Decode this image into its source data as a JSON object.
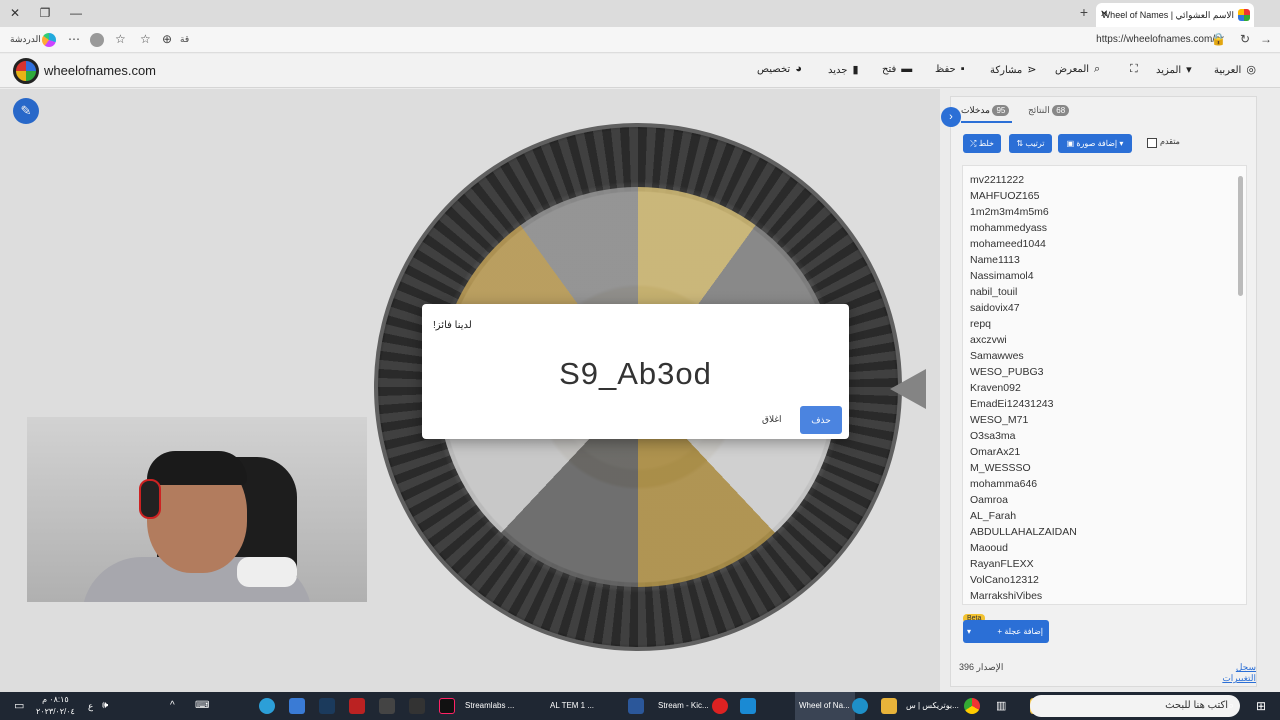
{
  "browser": {
    "tab_title": "الاسم العشوائي | Wheel of Names",
    "tab_close": "✕",
    "new_tab": "+",
    "url": "https://wheelofnames.com/ar",
    "profile_label": "الدردشة",
    "win_close": "✕",
    "win_restore": "❐",
    "win_min": "—",
    "reader_icon": "قة"
  },
  "site": {
    "title": "wheelofnames.com",
    "nav": {
      "language": "العربية",
      "more": "المزيد",
      "gallery": "المعرض",
      "share": "مشاركة",
      "save": "حفظ",
      "open": "فتح",
      "new": "جديد",
      "customize": "تخصيص"
    }
  },
  "panel": {
    "tab_entries": "مدخلات",
    "entries_count": "95",
    "tab_results": "النتائج",
    "results_count": "68",
    "shuffle": "خلط",
    "sort": "ترتيب",
    "add_image": "إضافة صورة",
    "advanced": "متقدم",
    "entries": [
      "mv2211222",
      "MAHFUOZ165",
      "1m2m3m4m5m6",
      "mohammedyass",
      "mohameed1044",
      "Name1113",
      "Nassimamol4",
      "nabil_touil",
      "saidovix47",
      "repq",
      "axczvwi",
      "Samawwes",
      "WESO_PUBG3",
      "Kraven092",
      "EmadEi12431243",
      "WESO_M71",
      "O3sa3ma",
      "OmarAx21",
      "M_WESSSO",
      "mohamma646",
      "Oamroa",
      "AL_Farah",
      "ABDULLAHALZAIDAN",
      "Maooud",
      "RayanFLEXX",
      "VolCano12312",
      "MarrakshiVibes"
    ],
    "beta": "Beta",
    "add_wheel": "إضافة عجلة",
    "version_label": "الإصدار",
    "version": "396",
    "changelog": "سجل التغييرات"
  },
  "dialog": {
    "title": "لدينا فائز!",
    "winner": "S9_Ab3od",
    "close": "اغلاق",
    "remove": "حذف"
  },
  "taskbar": {
    "search_placeholder": "اكتب هنا للبحث",
    "items": [
      "بوتريكس | س...",
      "Wheel of Na...",
      "Stream - Kic...",
      "AL TEM 1 ...",
      "Streamlabs ..."
    ],
    "time": "٠٨:١٥ م",
    "date": "٢٠٢٣/٠٢/٠٤",
    "lang": "ع"
  },
  "colors": {
    "accent": "#2b6fd6",
    "taskbar": "#1f2733"
  }
}
